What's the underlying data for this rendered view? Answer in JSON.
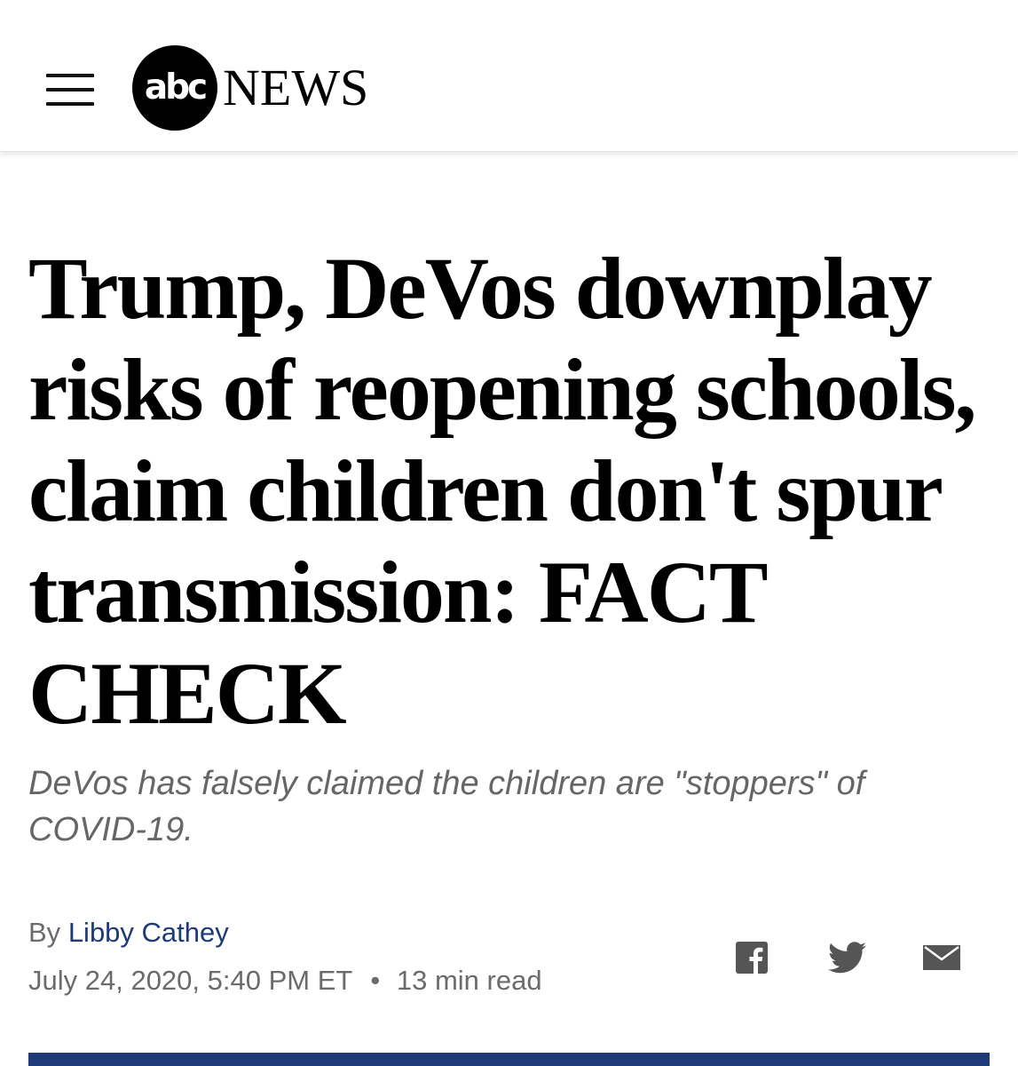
{
  "header": {
    "logo_abc": "abc",
    "logo_news": "NEWS",
    "menu_icon": "hamburger-menu-icon"
  },
  "article": {
    "headline": "Trump, DeVos downplay risks of reopening schools, claim children don't spur transmission: FACT CHECK",
    "subheadline": "DeVos has falsely claimed the children are \"stoppers\" of COVID-19.",
    "byline_prefix": "By",
    "author": "Libby Cathey",
    "date": "July 24, 2020, 5:40 PM ET",
    "separator": "•",
    "read_time": "13 min read"
  },
  "share": {
    "facebook_icon": "facebook-icon",
    "twitter_icon": "twitter-icon",
    "email_icon": "email-icon"
  },
  "colors": {
    "author_link": "#1d3b79",
    "meta_text": "#6b6b6b",
    "subhead_text": "#666666",
    "bottom_bar": "#1e3a78"
  }
}
